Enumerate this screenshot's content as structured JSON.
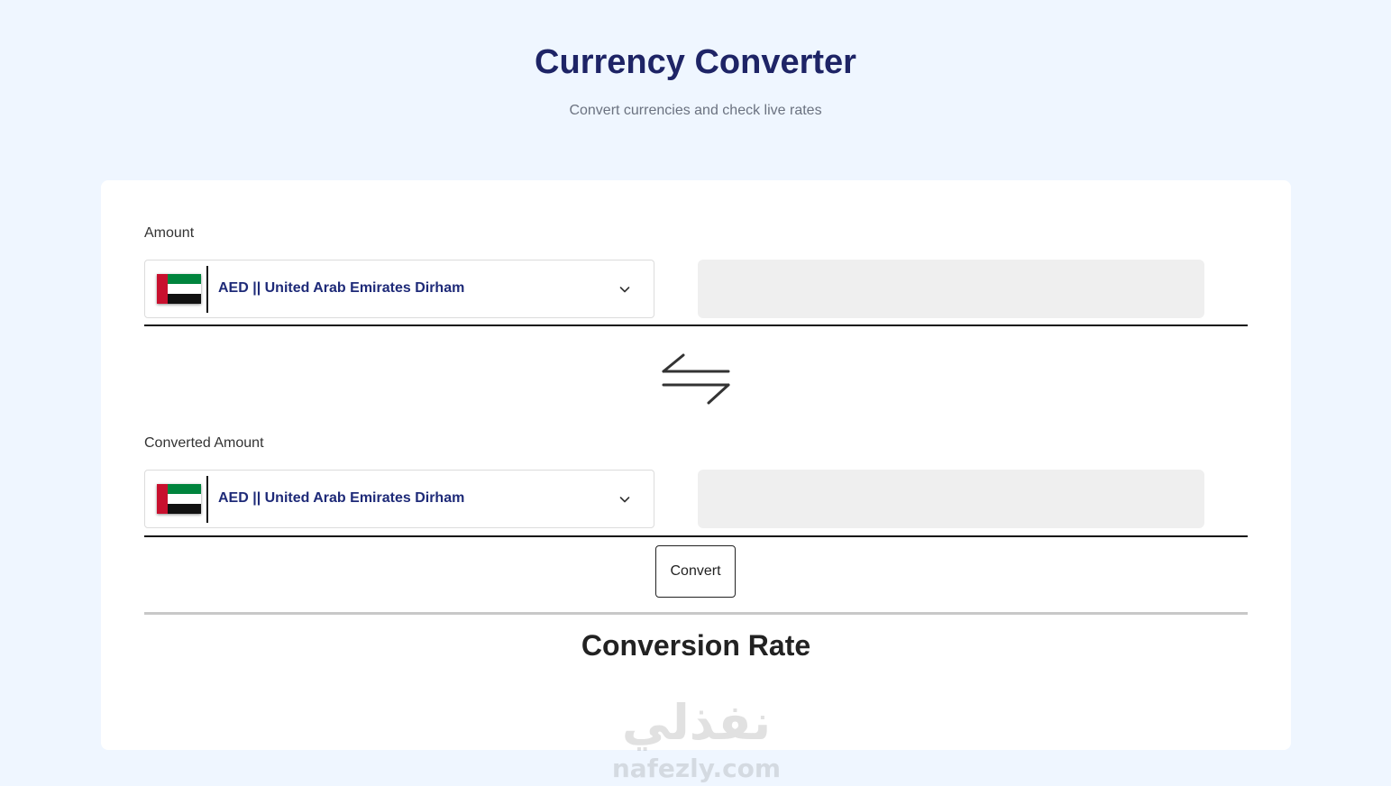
{
  "header": {
    "title": "Currency Converter",
    "subtitle": "Convert currencies and check live rates"
  },
  "from": {
    "label": "Amount",
    "currency": "AED || United Arab Emirates Dirham",
    "flag_icon": "uae-flag-icon",
    "amount_value": ""
  },
  "to": {
    "label": "Converted Amount",
    "currency": "AED || United Arab Emirates Dirham",
    "flag_icon": "uae-flag-icon",
    "amount_value": ""
  },
  "actions": {
    "swap_icon": "swap-arrows-icon",
    "convert_label": "Convert"
  },
  "rate": {
    "title": "Conversion Rate"
  },
  "watermark": {
    "arabic": "نفذلي",
    "latin": "nafezly.com"
  },
  "colors": {
    "page_bg": "#eff6ff",
    "title": "#1e2466",
    "currency_text": "#1e2a78",
    "input_bg": "#efefef"
  }
}
